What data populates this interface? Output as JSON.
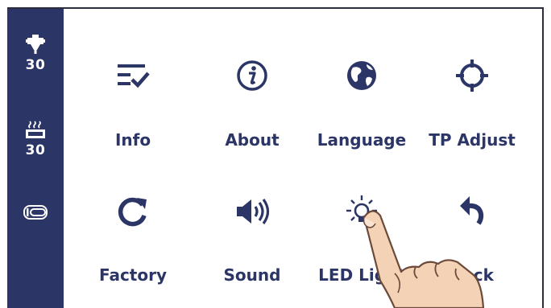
{
  "sidebar": {
    "nozzle_temp": "30",
    "bed_temp": "30",
    "icons": [
      "nozzle-icon",
      "heated-bed-icon",
      "fan-icon"
    ]
  },
  "menu": {
    "items": [
      {
        "label": "Info",
        "icon": "info-list-icon"
      },
      {
        "label": "About",
        "icon": "about-info-icon"
      },
      {
        "label": "Language",
        "icon": "globe-icon"
      },
      {
        "label": "TP Adjust",
        "icon": "crosshair-icon"
      },
      {
        "label": "Factory",
        "icon": "refresh-icon"
      },
      {
        "label": "Sound",
        "icon": "speaker-icon"
      },
      {
        "label": "LED Light",
        "icon": "light-bulb-icon"
      },
      {
        "label": "Back",
        "icon": "back-arrow-icon"
      }
    ]
  },
  "colors": {
    "sidebar_bg": "#2b3566",
    "accent": "#2b3566",
    "background": "#ffffff"
  }
}
